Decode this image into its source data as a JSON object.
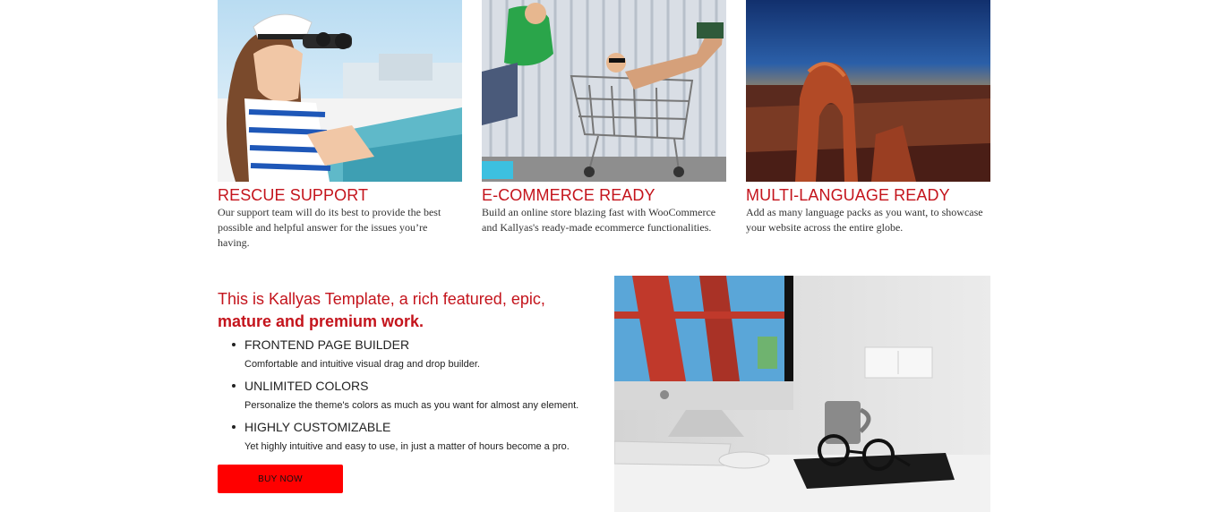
{
  "features_row": [
    {
      "title": "RESCUE SUPPORT",
      "text": "Our support team will do its best to provide the best possible and helpful answer for the issues you’re having.",
      "image": "woman-with-binoculars-photo"
    },
    {
      "title": "E-COMMERCE READY",
      "text": "Build an online store blazing fast with WooCommerce and Kallyas's ready-made ecommerce functionalities.",
      "image": "shopping-cart-girls-photo"
    },
    {
      "title": "MULTI-LANGUAGE READY",
      "text": "Add as many language packs as you want, to showcase your website across the entire globe.",
      "image": "desert-arch-photo"
    }
  ],
  "promo": {
    "heading_line1": "This is Kallyas Template, a rich featured, epic,",
    "heading_line2": "mature and premium work.",
    "items": [
      {
        "title": "FRONTEND PAGE BUILDER",
        "desc": "Comfortable and intuitive visual drag and drop builder."
      },
      {
        "title": "UNLIMITED COLORS",
        "desc": "Personalize the theme's colors as much as you want for almost any element."
      },
      {
        "title": "HIGHLY CUSTOMIZABLE",
        "desc": "Yet highly intuitive and easy to use, in just a matter of hours become a pro."
      }
    ],
    "button_label": "BUY NOW",
    "image": "desk-computer-photo"
  },
  "colors": {
    "accent": "#c4141c",
    "button": "#ff0000"
  }
}
